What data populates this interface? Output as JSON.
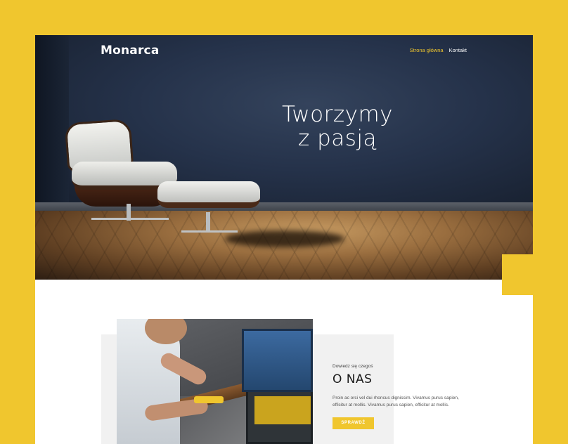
{
  "brand": {
    "logo": "Monarca",
    "accent_color": "#f0c62e"
  },
  "nav": {
    "items": [
      {
        "label": "Strona główna",
        "active": true
      },
      {
        "label": "Kontakt",
        "active": false
      }
    ]
  },
  "hero": {
    "title_line1": "Tworzymy",
    "title_line2": "z pasją"
  },
  "about": {
    "eyebrow": "Dowiedz się czegoś",
    "title": "O NAS",
    "body": "Proin ac orci vel dui rhoncus dignissim. Vivamus purus sapien, efficitur at mollis. Vivamus purus sapien, efficitur at mollis.",
    "button_label": "SPRAWDŹ"
  }
}
